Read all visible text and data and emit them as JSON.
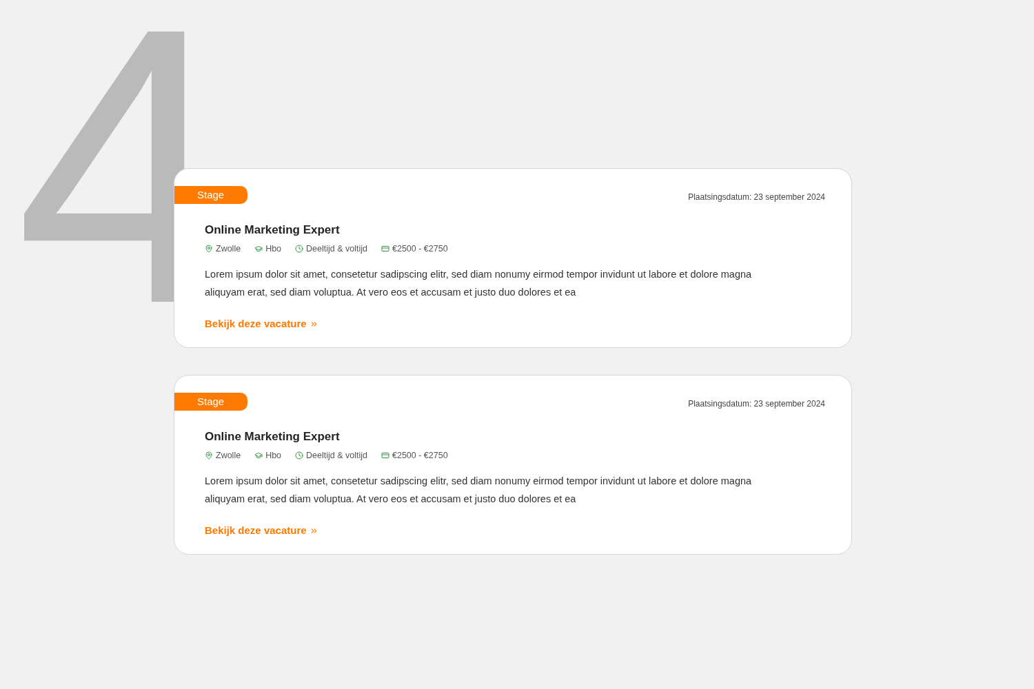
{
  "decoration": {
    "numeral": "4"
  },
  "vacancies": [
    {
      "badge": "Stage",
      "date": "Plaatsingsdatum: 23 september 2024",
      "title": "Online Marketing Expert",
      "meta": [
        {
          "kind": "location",
          "text": "Zwolle"
        },
        {
          "kind": "education",
          "text": "Hbo"
        },
        {
          "kind": "hours",
          "text": "Deeltijd & voltijd"
        },
        {
          "kind": "salary",
          "text": "€2500 - €2750"
        }
      ],
      "description": "Lorem ipsum dolor sit amet, consetetur sadipscing elitr, sed diam nonumy eirmod tempor invidunt ut labore et dolore magna aliquyam erat, sed diam voluptua. At vero eos et accusam et justo duo dolores et ea",
      "link": "Bekijk deze vacature"
    },
    {
      "badge": "Stage",
      "date": "Plaatsingsdatum: 23 september 2024",
      "title": "Online Marketing Expert",
      "meta": [
        {
          "kind": "location",
          "text": "Zwolle"
        },
        {
          "kind": "education",
          "text": "Hbo"
        },
        {
          "kind": "hours",
          "text": "Deeltijd & voltijd"
        },
        {
          "kind": "salary",
          "text": "€2500 - €2750"
        }
      ],
      "description": "Lorem ipsum dolor sit amet, consetetur sadipscing elitr, sed diam nonumy eirmod tempor invidunt ut labore et dolore magna aliquyam erat, sed diam voluptua. At vero eos et accusam et justo duo dolores et ea",
      "link": "Bekijk deze vacature"
    }
  ]
}
